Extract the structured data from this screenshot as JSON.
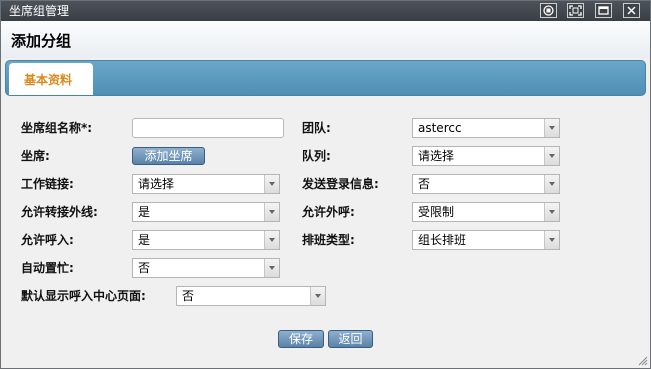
{
  "window": {
    "title": "坐席组管理",
    "controls": [
      "target-icon",
      "fullscreen-icon",
      "window-icon",
      "close-icon"
    ]
  },
  "header": {
    "title": "添加分组"
  },
  "tabs": [
    {
      "label": "基本资料",
      "active": true
    }
  ],
  "colors": {
    "tab_active_text": "#d98a1a",
    "tabbar": "#5a96bb",
    "button": "#6f95bb"
  },
  "form": {
    "group_name_label": "坐席组名称*:",
    "group_name_value": "",
    "agent_label": "坐席:",
    "add_agent_button": "添加坐席",
    "work_link_label": "工作链接:",
    "work_link_value": "请选择",
    "allow_transfer_label": "允许转接外线:",
    "allow_transfer_value": "是",
    "allow_inbound_label": "允许呼入:",
    "allow_inbound_value": "是",
    "auto_busy_label": "自动置忙:",
    "auto_busy_value": "否",
    "default_show_label": "默认显示呼入中心页面:",
    "default_show_value": "否",
    "team_label": "团队:",
    "team_value": "astercc",
    "queue_label": "队列:",
    "queue_value": "请选择",
    "send_login_label": "发送登录信息:",
    "send_login_value": "否",
    "allow_outbound_label": "允许外呼:",
    "allow_outbound_value": "受限制",
    "schedule_type_label": "排班类型:",
    "schedule_type_value": "组长排班"
  },
  "footer": {
    "save_button": "保存",
    "back_button": "返回"
  }
}
